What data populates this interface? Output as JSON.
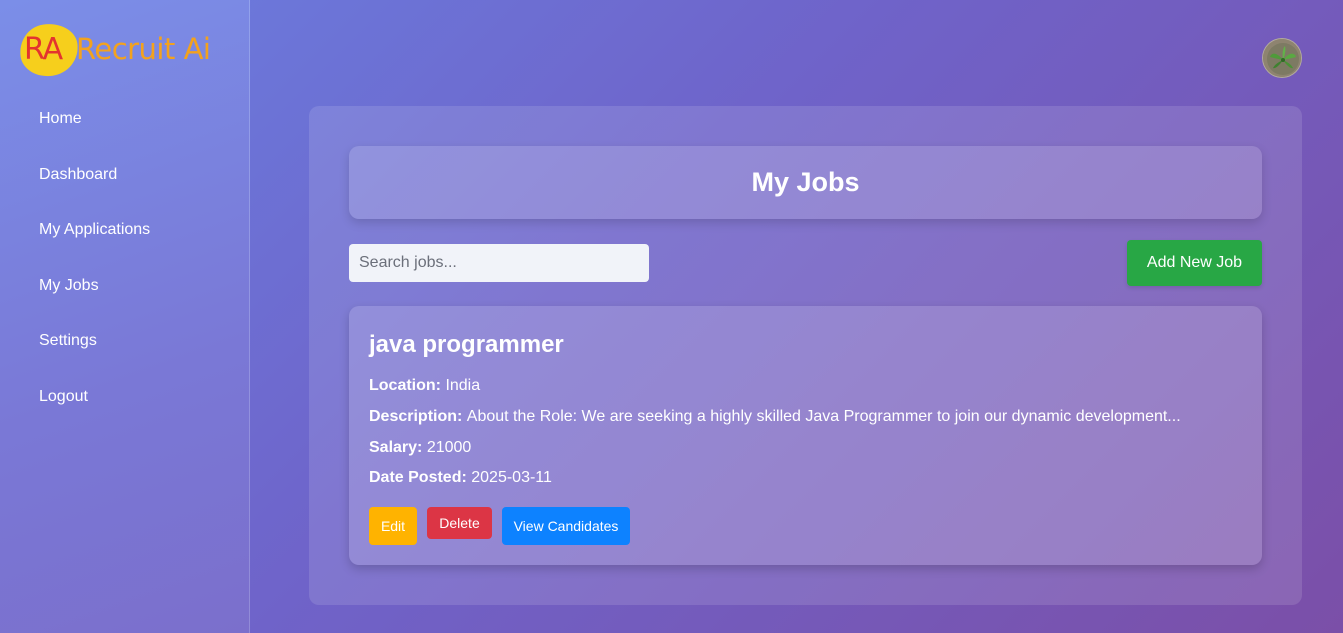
{
  "brand": {
    "mark": "RA",
    "name": "Recruit Ai"
  },
  "sidebar": {
    "items": [
      {
        "label": "Home"
      },
      {
        "label": "Dashboard"
      },
      {
        "label": "My Applications"
      },
      {
        "label": "My Jobs"
      },
      {
        "label": "Settings"
      },
      {
        "label": "Logout"
      }
    ]
  },
  "page": {
    "title": "My Jobs"
  },
  "toolbar": {
    "search_placeholder": "Search jobs...",
    "search_value": "",
    "add_label": "Add New Job"
  },
  "jobs": [
    {
      "title": "java programmer",
      "location_label": "Location:",
      "location": "India",
      "description_label": "Description:",
      "description": "About the Role: We are seeking a highly skilled Java Programmer to join our dynamic development...",
      "salary_label": "Salary:",
      "salary": "21000",
      "date_label": "Date Posted:",
      "date": "2025-03-11",
      "actions": {
        "edit": "Edit",
        "delete": "Delete",
        "view": "View Candidates"
      }
    }
  ],
  "colors": {
    "accent_green": "#28a745",
    "edit_yellow": "#ffb300",
    "delete_red": "#dc3545",
    "view_blue": "#0d82ff",
    "logo_yellow": "#f6cf1c",
    "logo_red": "#e3342f",
    "logo_orange": "#f3a21e"
  },
  "icons": {
    "avatar": "user-avatar-plant-photo"
  }
}
